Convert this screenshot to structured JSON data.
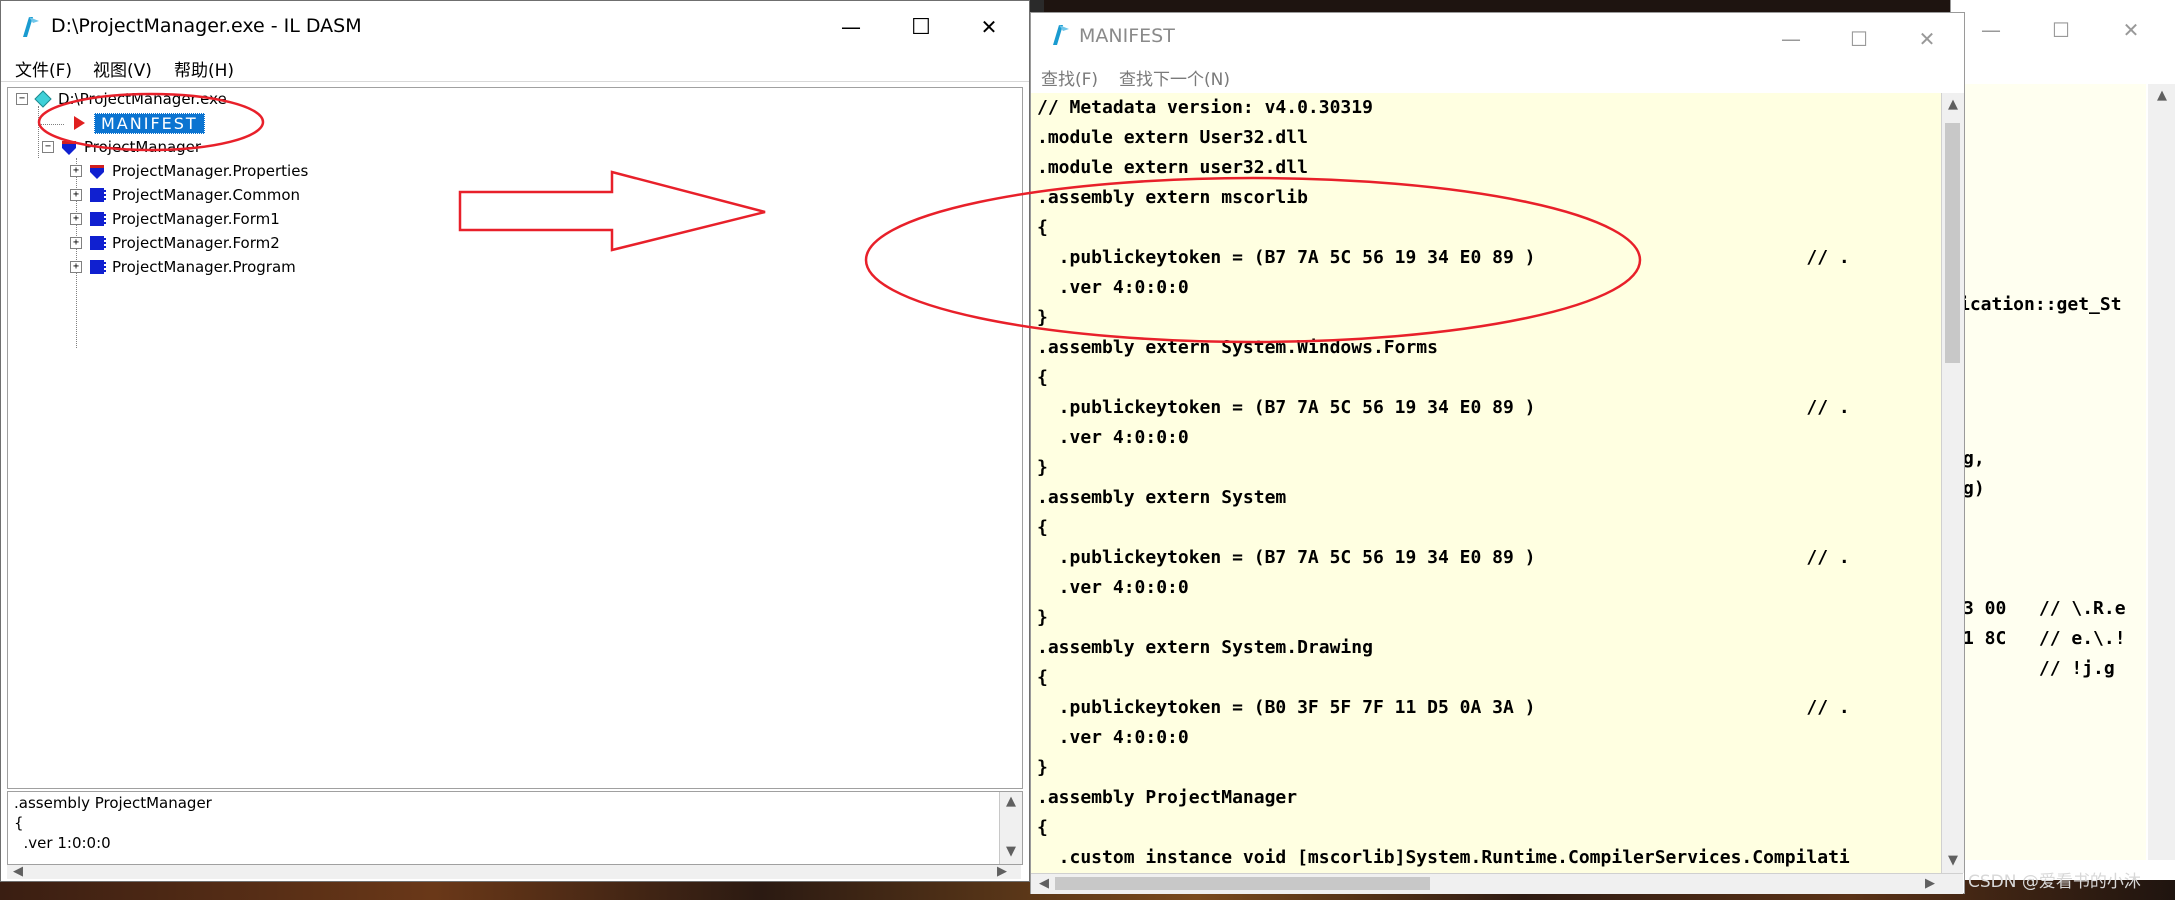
{
  "left_window": {
    "title": "D:\\ProjectManager.exe - IL DASM",
    "menu": [
      "文件(F)",
      "视图(V)",
      "帮助(H)"
    ],
    "tree": {
      "root": "D:\\ProjectManager.exe",
      "manifest": "MANIFEST",
      "namespace": "ProjectManager",
      "children": [
        "ProjectManager.Properties",
        "ProjectManager.Common",
        "ProjectManager.Form1",
        "ProjectManager.Form2",
        "ProjectManager.Program"
      ]
    },
    "info_lines": [
      ".assembly ProjectManager",
      "{",
      "  .ver 1:0:0:0"
    ]
  },
  "manifest_window": {
    "title": "MANIFEST",
    "menu": [
      "查找(F)",
      "查找下一个(N)"
    ],
    "code_lines": [
      "// Metadata version: v4.0.30319",
      ".module extern User32.dll",
      ".module extern user32.dll",
      ".assembly extern mscorlib",
      "{",
      "  .publickeytoken = (B7 7A 5C 56 19 34 E0 89 )                         // .",
      "  .ver 4:0:0:0",
      "}",
      ".assembly extern System.Windows.Forms",
      "{",
      "  .publickeytoken = (B7 7A 5C 56 19 34 E0 89 )                         // .",
      "  .ver 4:0:0:0",
      "}",
      ".assembly extern System",
      "{",
      "  .publickeytoken = (B7 7A 5C 56 19 34 E0 89 )                         // .",
      "  .ver 4:0:0:0",
      "}",
      ".assembly extern System.Drawing",
      "{",
      "  .publickeytoken = (B0 3F 5F 7F 11 D5 0A 3A )                         // .",
      "  .ver 4:0:0:0",
      "}",
      ".assembly ProjectManager",
      "{",
      "  .custom instance void [mscorlib]System.Runtime.CompilerServices.Compilati"
    ]
  },
  "background_window": {
    "fragments": [
      "ication::get_St",
      "g,",
      "g)",
      "3 00   // \\.R.e",
      "1 8C   // e.\\.!",
      "       // !j.g"
    ]
  },
  "watermark": "CSDN @爱看书的小沐",
  "colors": {
    "annotation_red": "#e8202a",
    "selection_blue": "#0b74d1",
    "code_bg": "#ffffe1"
  }
}
